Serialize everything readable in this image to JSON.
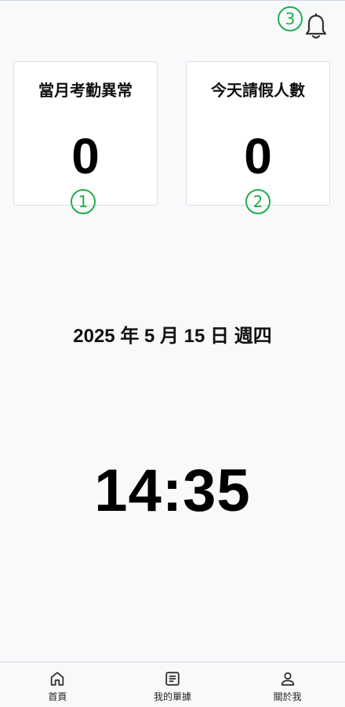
{
  "header": {
    "notification_badge": "3",
    "bell_icon": "bell-icon"
  },
  "cards": [
    {
      "title": "當月考勤異常",
      "value": "0",
      "badge": "1"
    },
    {
      "title": "今天請假人數",
      "value": "0",
      "badge": "2"
    }
  ],
  "main": {
    "date": "2025 年 5 月 15 日 週四",
    "time": "14:35"
  },
  "bottom_nav": {
    "items": [
      {
        "label": "首頁",
        "icon": "home-icon"
      },
      {
        "label": "我的單據",
        "icon": "document-icon"
      },
      {
        "label": "關於我",
        "icon": "person-icon"
      }
    ]
  },
  "colors": {
    "accent_badge": "#1fae4b",
    "background": "#f8f9fb"
  }
}
